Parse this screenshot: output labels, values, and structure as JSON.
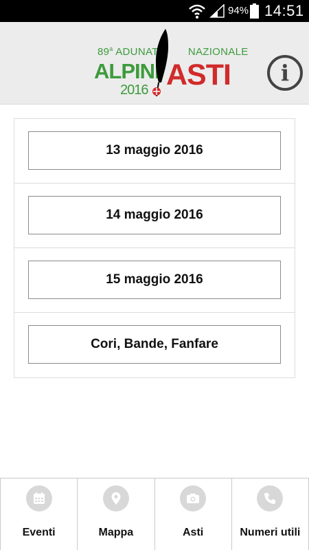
{
  "status_bar": {
    "battery_percent": "94%",
    "time": "14:51",
    "icons": [
      "wifi-icon",
      "signal-icon",
      "battery-icon"
    ]
  },
  "header": {
    "logo": {
      "top_line_number": "89",
      "top_line_sup": "a",
      "top_line_text_1": " ADUNATA",
      "top_line_text_2": "NAZIONALE",
      "alpini": "ALPINI",
      "year": "2016",
      "asti": "ASTI"
    },
    "info_icon": "i"
  },
  "list": {
    "items": [
      {
        "label": "13 maggio 2016"
      },
      {
        "label": "14 maggio 2016"
      },
      {
        "label": "15 maggio 2016"
      },
      {
        "label": "Cori, Bande, Fanfare"
      }
    ]
  },
  "tabs": [
    {
      "label": "Eventi",
      "icon": "calendar-icon"
    },
    {
      "label": "Mappa",
      "icon": "map-pin-icon"
    },
    {
      "label": "Asti",
      "icon": "camera-icon"
    },
    {
      "label": "Numeri utili",
      "icon": "phone-icon"
    }
  ],
  "colors": {
    "green": "#3d9b3d",
    "red": "#d12b2b",
    "header_bg": "#ececec",
    "tab_icon_bg": "#d8d8d8"
  }
}
